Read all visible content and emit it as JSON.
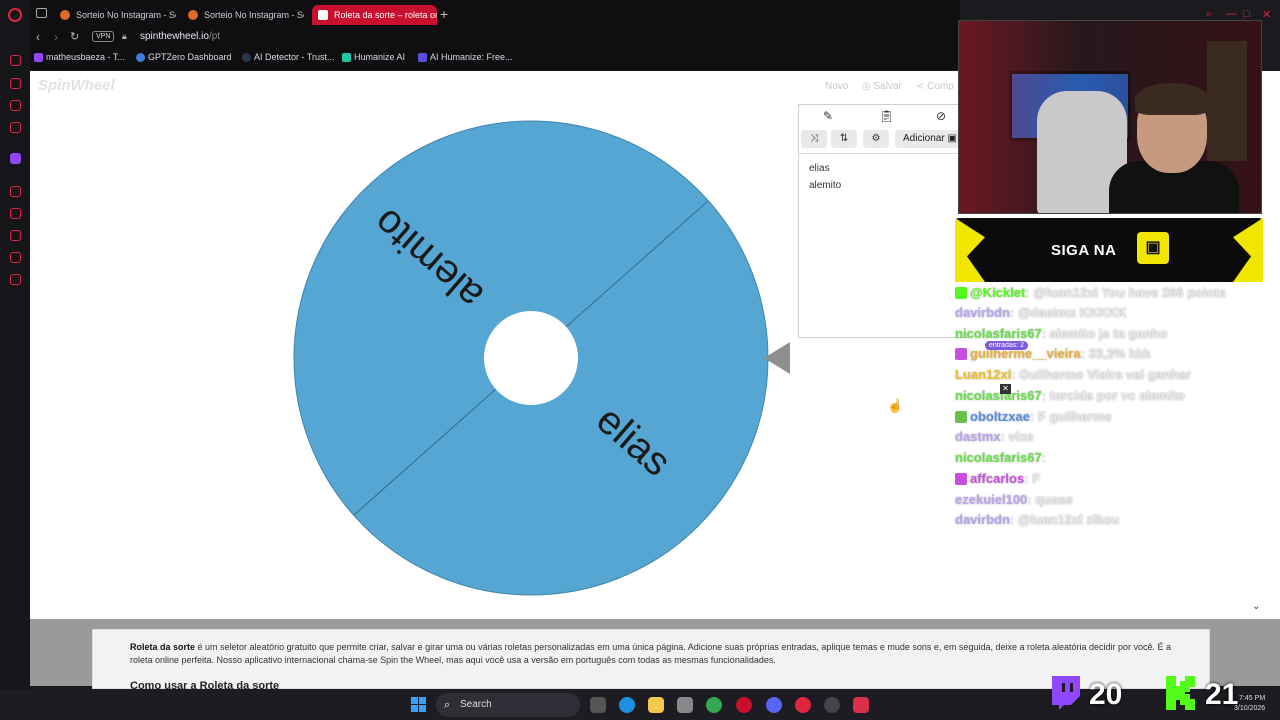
{
  "tabs": [
    {
      "label": "Sorteio No Instagram - So",
      "active": false
    },
    {
      "label": "Sorteio No Instagram - So",
      "active": false
    },
    {
      "label": "Roleta da sorte – roleta on",
      "active": true
    }
  ],
  "address": {
    "vpn": "VPN",
    "host": "spinthewheel.io",
    "path": "/pt"
  },
  "bookmarks": [
    "matheusbaeza - T...",
    "GPTZero Dashboard",
    "AI Detector - Trust...",
    "Humanize AI",
    "AI Humanize: Free..."
  ],
  "site": {
    "brand": "SpinWheel",
    "nav": {
      "new": "Novo",
      "save": "Salvar",
      "share": "Comp"
    },
    "add_label": "Adicionar",
    "entries": [
      "elias",
      "alemito"
    ],
    "wheel": {
      "color": "#55a6d2",
      "labels": [
        "alemito",
        "elias"
      ]
    },
    "description": {
      "bold": "Roleta da sorte",
      "text": " é um seletor aleatório gratuito que permite criar, salvar e girar uma ou várias roletas personalizadas em uma única página. Adicione suas próprias entradas, aplique temas e mude sons e, em seguida, deixe a roleta aleatória decidir por você. É a roleta online perfeita. Nosso aplicativo internacional chama-se Spin the Wheel, mas aqui você usa a versão em português com todas as mesmas funcionalidades.",
      "heading": "Como usar a Roleta da sorte"
    }
  },
  "overlay": {
    "siga": "SIGA NA",
    "entradas": "entradas: 2",
    "chat": [
      {
        "user": "@Kicklet",
        "color": "#53fc18",
        "text": ": @luan12xl You have 266 points"
      },
      {
        "user": "davirbdn",
        "color": "#b9a6ee",
        "text": ": @dastmx KKKKK"
      },
      {
        "user": "nicolasfaris67",
        "color": "#69e04a",
        "text": ": alemito ja ta ganho"
      },
      {
        "user": "guilherme__vieira",
        "color": "#e8b13a",
        "text": ": 33,3% kkk"
      },
      {
        "user": "Luan12xl",
        "color": "#f0c020",
        "text": ": Guilherme Vieira vai ganhar"
      },
      {
        "user": "nicolasfaris67",
        "color": "#69e04a",
        "text": ": torcida por vc alemito"
      },
      {
        "user": "oboltzxae",
        "color": "#5a8fe0",
        "text": ": F guilherme"
      },
      {
        "user": "dastmx",
        "color": "#b9a6ee",
        "text": ": vixe"
      },
      {
        "user": "nicolasfaris67",
        "color": "#69e04a",
        "text": ":"
      },
      {
        "user": "affcarlos",
        "color": "#c850e0",
        "text": ": F"
      },
      {
        "user": "ezekuiel100",
        "color": "#b9a6ee",
        "text": ": quase"
      },
      {
        "user": "davirbdn",
        "color": "#b9a6ee",
        "text": ": @luan12xl zikou"
      }
    ],
    "twitch_count": "20",
    "kick_count": "21"
  },
  "taskbar": {
    "search": "Search",
    "time": "7:45 PM",
    "date": "3/10/2026"
  },
  "colors": {
    "opera_red": "#e0263f",
    "twitch": "#9146ff",
    "kick": "#53fc18"
  }
}
